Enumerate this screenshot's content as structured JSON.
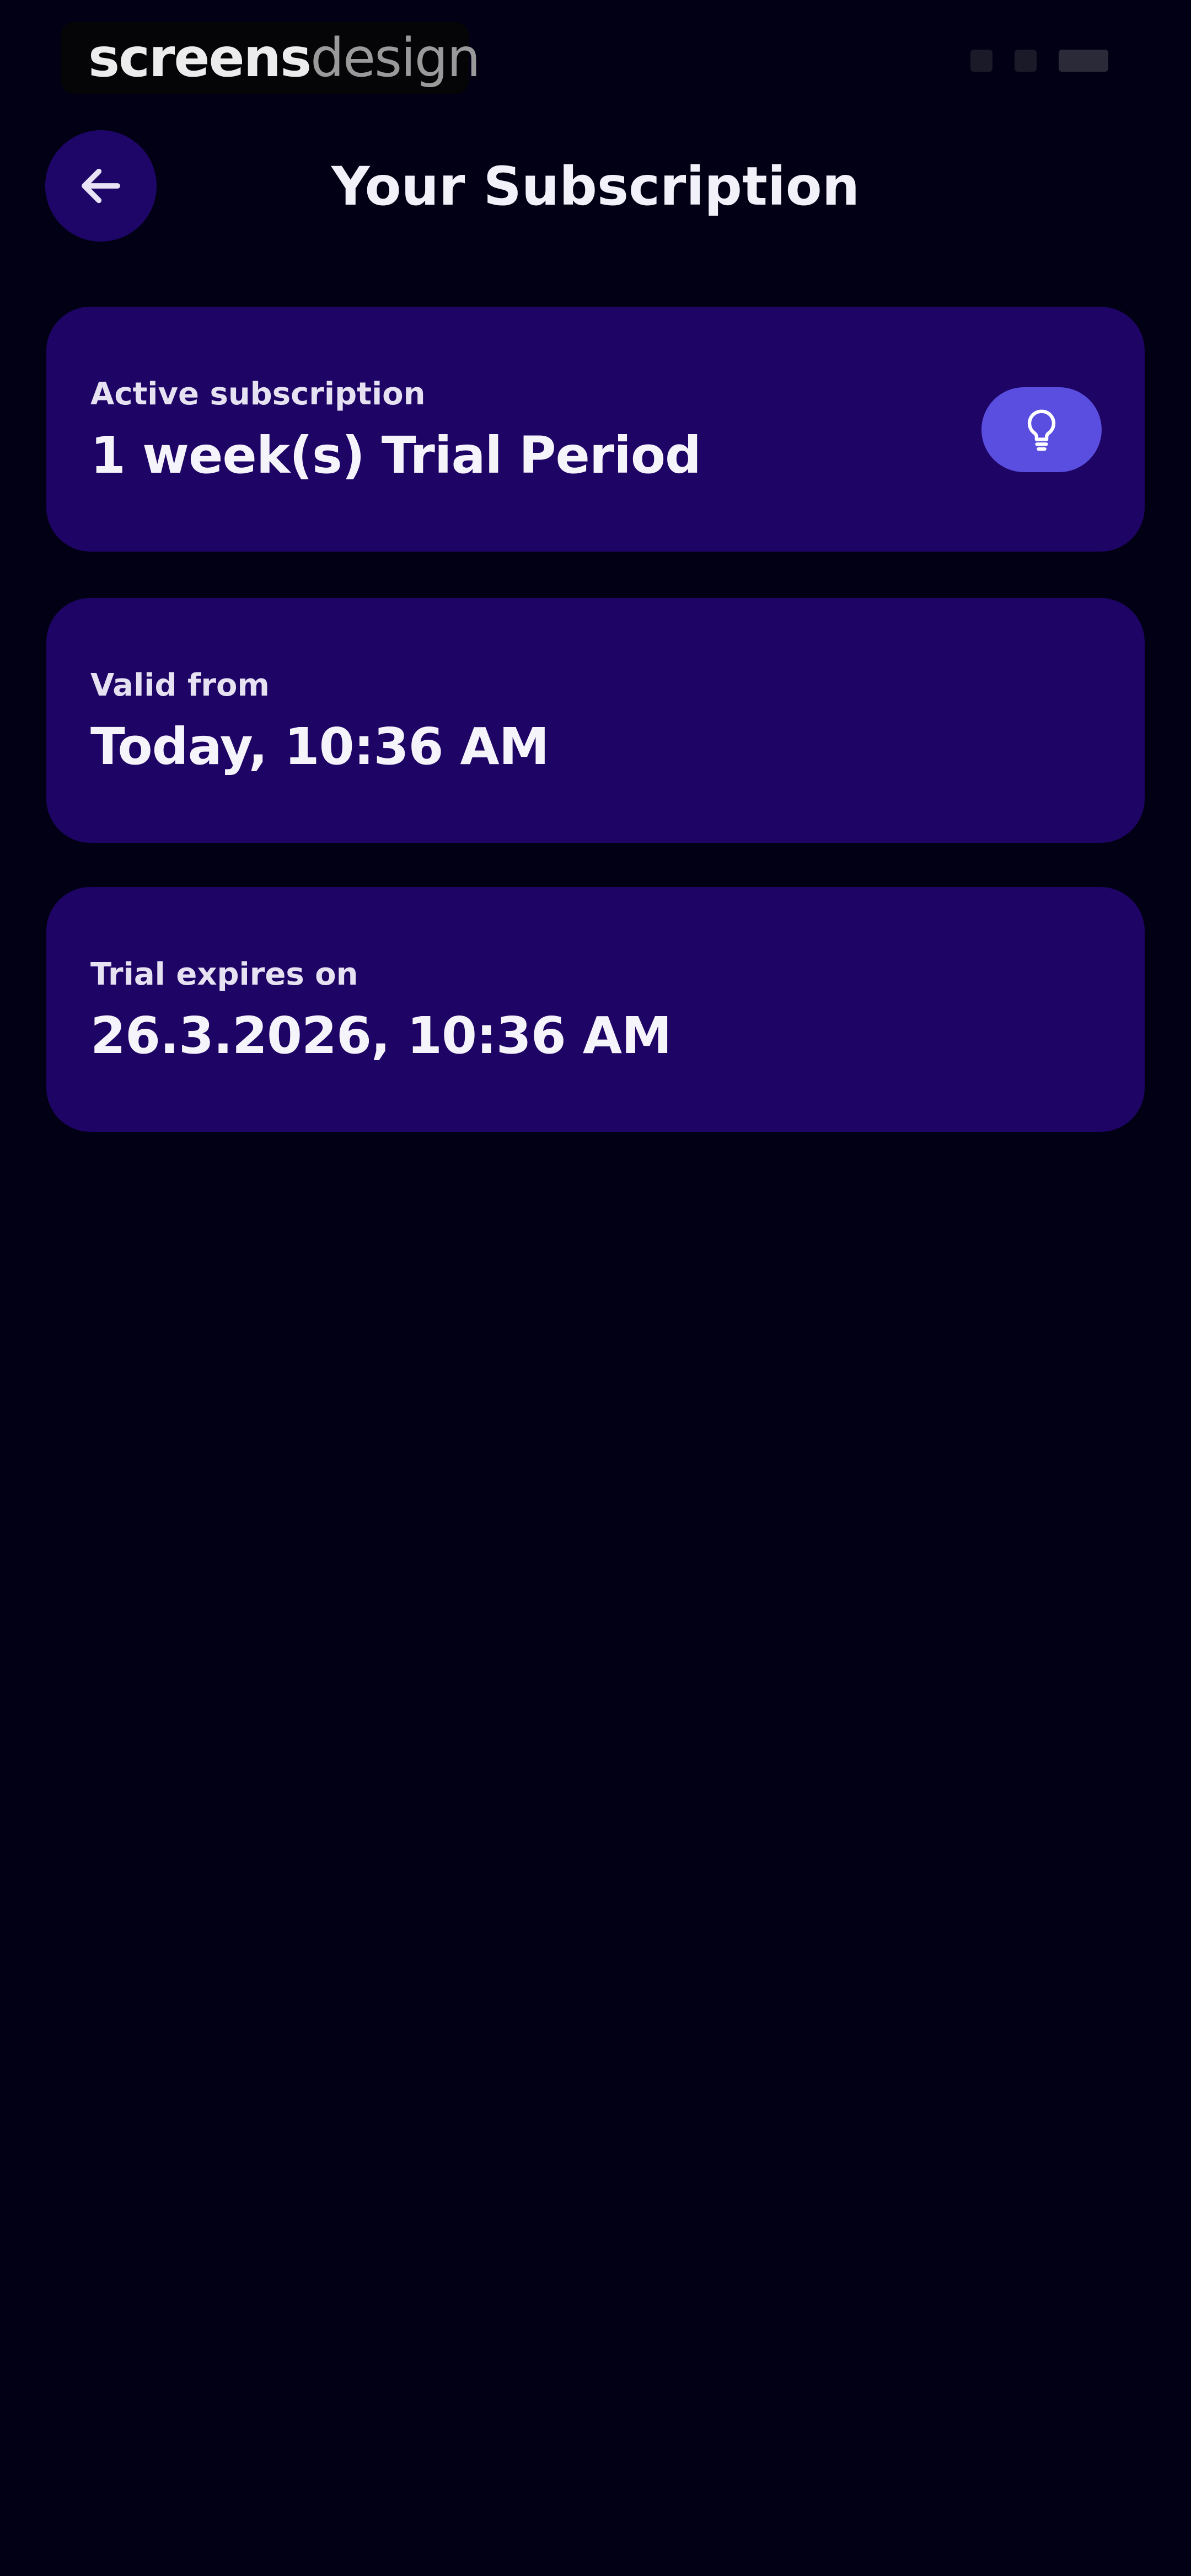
{
  "watermark": {
    "part1": "screens",
    "part2": "design"
  },
  "header": {
    "title": "Your Subscription",
    "back_icon": "arrow-left-icon"
  },
  "cards": [
    {
      "label": "Active subscription",
      "value": "1 week(s) Trial Period",
      "icon": "lightbulb-icon"
    },
    {
      "label": "Valid from",
      "value": "Today, 10:36 AM"
    },
    {
      "label": "Trial expires on",
      "value": "26.3.2026, 10:36 AM"
    }
  ],
  "colors": {
    "background": "#020014",
    "card": "#1e0464",
    "back_button": "#1e0668",
    "badge": "#5a4ee0",
    "text": "#ffffff"
  }
}
